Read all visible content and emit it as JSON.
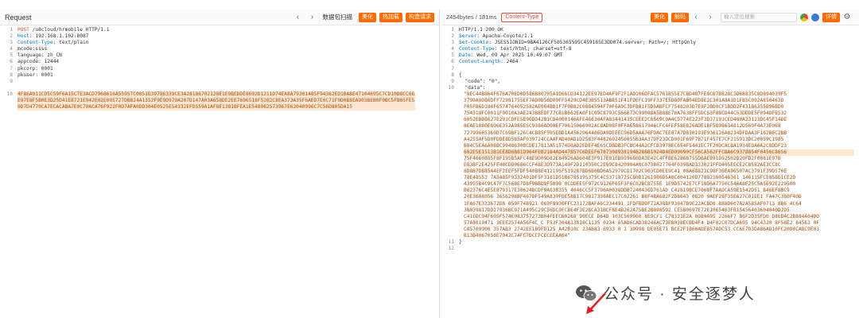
{
  "request": {
    "title": "Request",
    "action_text": "数据包扫描",
    "buttons": [
      "美化",
      "热加载",
      "构造请求"
    ],
    "lines": [
      {
        "n": "1",
        "type": "reqline",
        "method": "POST",
        "url": " /u8cloud/hrmobile HTTP/1.1"
      },
      {
        "n": "2",
        "type": "hdr",
        "name": "Host",
        "value": ": 192.168.1.102:8087"
      },
      {
        "n": "3",
        "type": "hdr",
        "name": "Content-Type",
        "value": ": text/plain"
      },
      {
        "n": "4",
        "type": "plain",
        "text": "mcode:ssss"
      },
      {
        "n": "5",
        "type": "plain",
        "text": "language: zh_CN"
      },
      {
        "n": "6",
        "type": "plain",
        "text": "appcode: 12444"
      },
      {
        "n": "7",
        "type": "plain",
        "text": "pkcorp: 0001"
      },
      {
        "n": "8",
        "type": "plain",
        "text": "pkuser: 0001"
      },
      {
        "n": "9",
        "type": "plain",
        "text": ""
      },
      {
        "n": "10",
        "type": "hex",
        "text": "4F86A911CD5C59F6A15C7E3ACD7968616A55957C0051D39786339CE3A28186702128E1E9BEDDE8692D1211D74EA8A79301485F94362ED1BABE47104695C7CD10D8CC66E97E8F5B0E3D25D41E8721E942E02E095727DB824A1352F9E9D979A207D147A03A658DE2EE7696518F5262C8EA373A35F6AED7E0C71F9D0B8EA903BEB0F0BC5FB05FE50D7D4770CA7ECACABA7E0C79ACA76F922F0D7AFA0DD304E0525E54332EFD559A1AF8E1381BFEA1E548062573967E62040996C7C56D805DA15"
      }
    ]
  },
  "response": {
    "bytes": "2454bytes / 181ms",
    "content_type_badge": "Content-Type",
    "buttons": [
      "美化",
      "解码"
    ],
    "search_placeholder": "输入定位搜索",
    "detail_button": "详情",
    "lines": [
      {
        "n": "1",
        "type": "status",
        "text": "HTTP/1.1 200 OK"
      },
      {
        "n": "2",
        "type": "hdr",
        "name": "Server",
        "value": ": Apache-Coyote/1.1"
      },
      {
        "n": "3",
        "type": "hdr",
        "name": "Set-Cookie",
        "value": ": JSESSIONID=9BA4126CF505365595C459165E3DD074.server; Path=/; HttpOnly"
      },
      {
        "n": "4",
        "type": "hdr",
        "name": "Content-Type",
        "value": ": text/html; charset=utf-8"
      },
      {
        "n": "5",
        "type": "hdr",
        "name": "Date",
        "value": ": Wed, 09 Apr 2025 10:49:07 GMT"
      },
      {
        "n": "6",
        "type": "hdr",
        "name": "Content-Length",
        "value": ": 2464"
      },
      {
        "n": "7",
        "type": "plain",
        "text": ""
      },
      {
        "n": "8",
        "type": "plain",
        "text": "{"
      },
      {
        "n": "9",
        "type": "plain",
        "text": "  \"code\": \"0\","
      },
      {
        "n": "10",
        "type": "plain",
        "text": "  \"data\":"
      },
      {
        "n": "11",
        "type": "plain",
        "text": "}"
      },
      {
        "n": "12",
        "type": "plain",
        "text": ""
      }
    ],
    "data_hex": [
      "\"8EC44B864F676A70ED0D586B80705A1D66CD34122EE97ED4AF9F2F1AD106DFAC5761B55E7CBD487FE8CB7B828C3D68835C8D894039F5",
      "3799A9D86DFF72981755EF7A80D56D09FF5429CD4E3B5513AB851F41FDEFC19FF337E5D80FAB04ED8E2C301A8A1D1FB5C092A850463D",
      "F05FB6D184F6574764052582AE004BD1F7F0B82C0884594F70F6A9C3DFB81F5D5ABFCF7548203D7E9F2BD0CF1BDD2F431B6355B96BD0",
      "754318FC0011F0010A3AE2438BEDF77CB1B662EA0F1C09C8793C566B73C99088A5B88E76A763BFF5DC53F8BCD44C53DDDE5F094DFB532",
      "6052EBD8627E291CDFE5E96DD4281CD4000146AFE46630AFA83441435CEEE2C8569C9A4C9774E223F3D37191CED480A23123DC45F14DE",
      "8EAE1880E896E352A985E5C9386AD00EF79615066902AC8AD08F0FFA658617946CFC4FEF58E826ADE1BF5898634812D569F4A73E068",
      "72799665369D7C69BF126C4C885F595EBD1A4562964406DA9DEEEC96D5AAA76FDAC7EE87A7D830193E936126A8234DFDAA3F162B6C2BB",
      "A4255AF5D0FDDE8D585AF039724CCAAFAD40AD1D2583F4482602456055B3AA37DF23DCD001F69F7B71F457E7CF215913DC20059C1985",
      "B84C5EA6A08BC99486308CDE17813A51574D8AD2EDEF4E6SCDBDB3FCBC44A2CFCB3978EC654F5441EC7F20DCACBA1934EDA6A2C8DDF23",
      "682E5E1513B1EE8D6B81D964FEB2184AD447B57C6DEEF6787308938194B286B1024D4ED09090CF56CA562FFCBA6C9378854F0456C8656",
      "75F4660885F8F195B5AFC48E9D09D82E84926AD604E3F917E81EB959680DA3E42C4FFBE62868755DBAE891D92502D20FD2F0081E97B",
      "E83BF2E425FE48CDD0686CCF48E3D973A149F2D110350C2E89C8420904A0C0738627764F0398AD323021FFD405EECE2CB582AE3CC8C",
      "8D8B7DB85A4EF2EEF5FDF540B8E412195F519287BD6B0BD6A52979CD1702C963CD0EE9C41 08A68823C98F36EA96507AC3791F39D570E",
      "78E48553 7A5A85F9332401DF5F3181D5186785195375C4C53718725CB0B1261980D5A0C604120D77882100546361 146115FCE85BD1CE2D",
      "43955B4C9C47F7C568E7D8F9BBD8F5898 0CDDEE5F972C9126F65F3F6C02BCB755E 1E9D5742E7CF18D6A7750C546A8E25C5A5692E229500",
      "B62376C4E5E879317E30624BCDF9A038355 4046CC5F3796A0038DDB7240436D761AD C42819BCE7068F7AADCA59E1542D51 B46EF8BC9",
      "20E36A8056 3656298BF467DF549A839FDE58B17C9817336AEC17C02261 B8F4BA682F2D8643 0820 9AEF28F35E627C01EE1 FA47C380F40D",
      "1FA67E333672D8 059F748921 069F8930FFC23172BAFA6C234491 1FDFBD9F72A388F93047B9E22ACBD0 888D607A2A585AF0713 8B6 4C64",
      "3B839817DD27936BC971A495C29C56DC9FCBE4F3E28CA31BCF8E4B262A75BE2B098592 CE5B0697E72E1065463FB15456403604040D2D5",
      "C41EDC94F605F574E083757273B04FEECB0268 90ECE D64D 103C569900 8E9CF1 C78331E2A 0989A95 2266F7 86F2D35FD0 D8ED4C2B884A04DD",
      "57A8019471 3EEE2574A56F4C C F53F304A13818C1135 0234 65AD6CAD38246AC73EB038ECBD4F4 D4F02C07DCA695 94C4320 8F58E2 84563 0F",
      "C85709900 357AB3 2742EE1B9FD125 A42B10C 23AB83 6933 0 1 39998 DE05E71 BCE2F1B60ADE857ADC53 CC6E7D3DA86AD10FC20D0CADC9E03",
      "B13B4067056E7042C74FC7DCCFCECEEAA04\""
    ]
  },
  "watermark": {
    "text": "公众号 · 安全逐梦人"
  }
}
